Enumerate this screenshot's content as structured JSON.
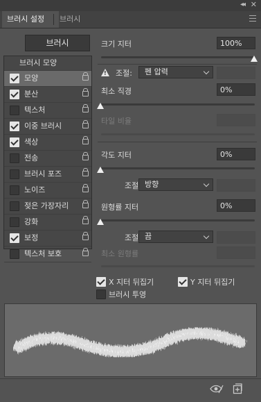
{
  "window": {
    "collapse_icon": "double-chevron-icon",
    "close_icon": "close-icon"
  },
  "tabs": [
    {
      "label": "브러시 설정",
      "active": true
    },
    {
      "label": "브러시",
      "active": false
    }
  ],
  "panel_menu_icon": "hamburger-icon",
  "brush_button": "브러시",
  "list": {
    "header": "브러시 모양",
    "items": [
      {
        "label": "모양",
        "checked": true,
        "selected": true
      },
      {
        "label": "분산",
        "checked": true,
        "selected": false
      },
      {
        "label": "텍스처",
        "checked": false,
        "selected": false
      },
      {
        "label": "이중 브러시",
        "checked": true,
        "selected": false
      },
      {
        "label": "색상",
        "checked": true,
        "selected": false
      },
      {
        "label": "전송",
        "checked": false,
        "selected": false
      },
      {
        "label": "브러시 포즈",
        "checked": false,
        "selected": false
      },
      {
        "label": "노이즈",
        "checked": false,
        "selected": false
      },
      {
        "label": "젖은 가장자리",
        "checked": false,
        "selected": false
      },
      {
        "label": "강화",
        "checked": false,
        "selected": false
      },
      {
        "label": "보정",
        "checked": true,
        "selected": false
      },
      {
        "label": "텍스처 보호",
        "checked": false,
        "selected": false
      }
    ]
  },
  "size_jitter": {
    "label": "크기 지터",
    "value": "100%",
    "slider": 1.0
  },
  "size_control": {
    "label": "조절:",
    "value": "펜 압력",
    "warning_icon": "warning-icon"
  },
  "min_diameter": {
    "label": "최소 직경",
    "value": "0%",
    "slider": 0.0
  },
  "tilt_scale": {
    "label": "타일 비율",
    "enabled": false
  },
  "angle_jitter": {
    "label": "각도 지터",
    "value": "0%",
    "slider": 0.0
  },
  "angle_control": {
    "label": "조절:",
    "value": "방향"
  },
  "roundness_jitter": {
    "label": "원형률 지터",
    "value": "0%",
    "slider": 0.0
  },
  "roundness_control": {
    "label": "조절:",
    "value": "끔"
  },
  "min_roundness": {
    "label": "최소 원형률",
    "enabled": false
  },
  "flip_x": {
    "label": "X 지터 뒤집기",
    "checked": true
  },
  "flip_y": {
    "label": "Y 지터 뒤집기",
    "checked": true
  },
  "brush_projection": {
    "label": "브러시 투영",
    "checked": false
  },
  "footer": {
    "toggle_icon": "eye-toggle-icon",
    "new_icon": "new-brush-icon"
  }
}
